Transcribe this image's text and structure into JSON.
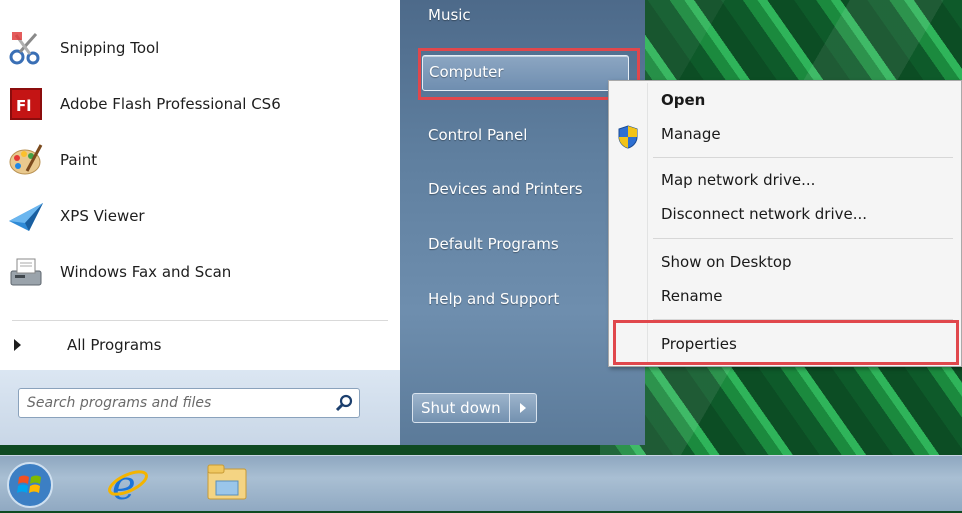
{
  "start_menu": {
    "programs": [
      {
        "label": "Snipping Tool",
        "icon": "scissors-icon"
      },
      {
        "label": "Adobe Flash Professional CS6",
        "icon": "flash-icon"
      },
      {
        "label": "Paint",
        "icon": "paint-palette-icon"
      },
      {
        "label": "XPS Viewer",
        "icon": "xps-viewer-icon"
      },
      {
        "label": "Windows Fax and Scan",
        "icon": "fax-scanner-icon"
      }
    ],
    "all_programs_label": "All Programs",
    "search_placeholder": "Search programs and files",
    "right_items": {
      "music": "Music",
      "computer": "Computer",
      "control_panel": "Control Panel",
      "devices_printers": "Devices and Printers",
      "default_programs": "Default Programs",
      "help_support": "Help and Support"
    },
    "shutdown_label": "Shut down",
    "flash_icon_text": "Fl"
  },
  "context_menu": {
    "open": "Open",
    "manage": "Manage",
    "map_drive": "Map network drive...",
    "disconnect_drive": "Disconnect network drive...",
    "show_desktop": "Show on Desktop",
    "rename": "Rename",
    "properties": "Properties"
  },
  "colors": {
    "highlight_red": "#e0474c",
    "right_pane_blue": "#5f7f9f"
  }
}
